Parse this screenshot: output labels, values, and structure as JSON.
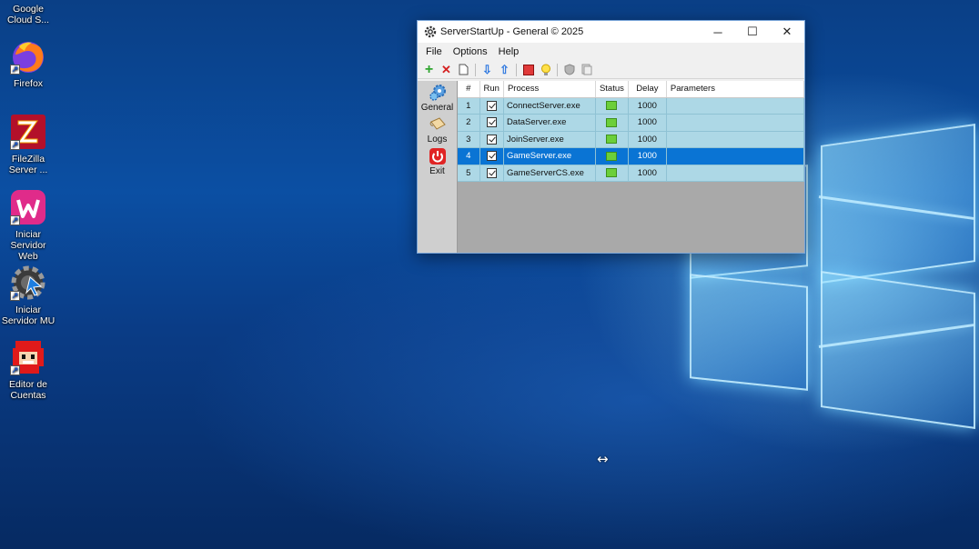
{
  "desktop": {
    "icons": [
      {
        "label": "Google Cloud S...",
        "icon": "google-cloud-sdk-icon"
      },
      {
        "label": "Firefox",
        "icon": "firefox-icon"
      },
      {
        "label": "FileZilla Server ...",
        "icon": "filezilla-icon"
      },
      {
        "label": "Iniciar Servidor Web",
        "icon": "web-server-icon"
      },
      {
        "label": "Iniciar Servidor MU",
        "icon": "mu-server-icon"
      },
      {
        "label": "Editor de Cuentas",
        "icon": "account-editor-icon"
      }
    ]
  },
  "window": {
    "title": "ServerStartUp - General © 2025",
    "controls": {
      "minimize": "─",
      "maximize": "☐",
      "close": "✕"
    },
    "menu": [
      "File",
      "Options",
      "Help"
    ],
    "toolbar": [
      "add-icon",
      "delete-icon",
      "new-document-icon",
      "move-down-icon",
      "move-up-icon",
      "stop-icon",
      "bulb-icon",
      "shield-icon",
      "copy-icon"
    ],
    "sidebar": [
      {
        "label": "General",
        "icon": "gears-icon"
      },
      {
        "label": "Logs",
        "icon": "scroll-icon"
      },
      {
        "label": "Exit",
        "icon": "power-icon"
      }
    ],
    "table": {
      "headers": [
        "#",
        "Run",
        "Process",
        "Status",
        "Delay",
        "Parameters"
      ],
      "rows": [
        {
          "num": "1",
          "run": true,
          "process": "ConnectServer.exe",
          "status": "running",
          "delay": "1000",
          "params": ""
        },
        {
          "num": "2",
          "run": true,
          "process": "DataServer.exe",
          "status": "running",
          "delay": "1000",
          "params": ""
        },
        {
          "num": "3",
          "run": true,
          "process": "JoinServer.exe",
          "status": "running",
          "delay": "1000",
          "params": ""
        },
        {
          "num": "4",
          "run": true,
          "process": "GameServer.exe",
          "status": "running",
          "delay": "1000",
          "params": "",
          "selected": true
        },
        {
          "num": "5",
          "run": true,
          "process": "GameServerCS.exe",
          "status": "running",
          "delay": "1000",
          "params": ""
        }
      ]
    }
  },
  "colors": {
    "row_bg": "#add8e6",
    "selected_row": "#0a74d4",
    "status_ok": "#6ccf3a"
  },
  "cursor": "↔"
}
